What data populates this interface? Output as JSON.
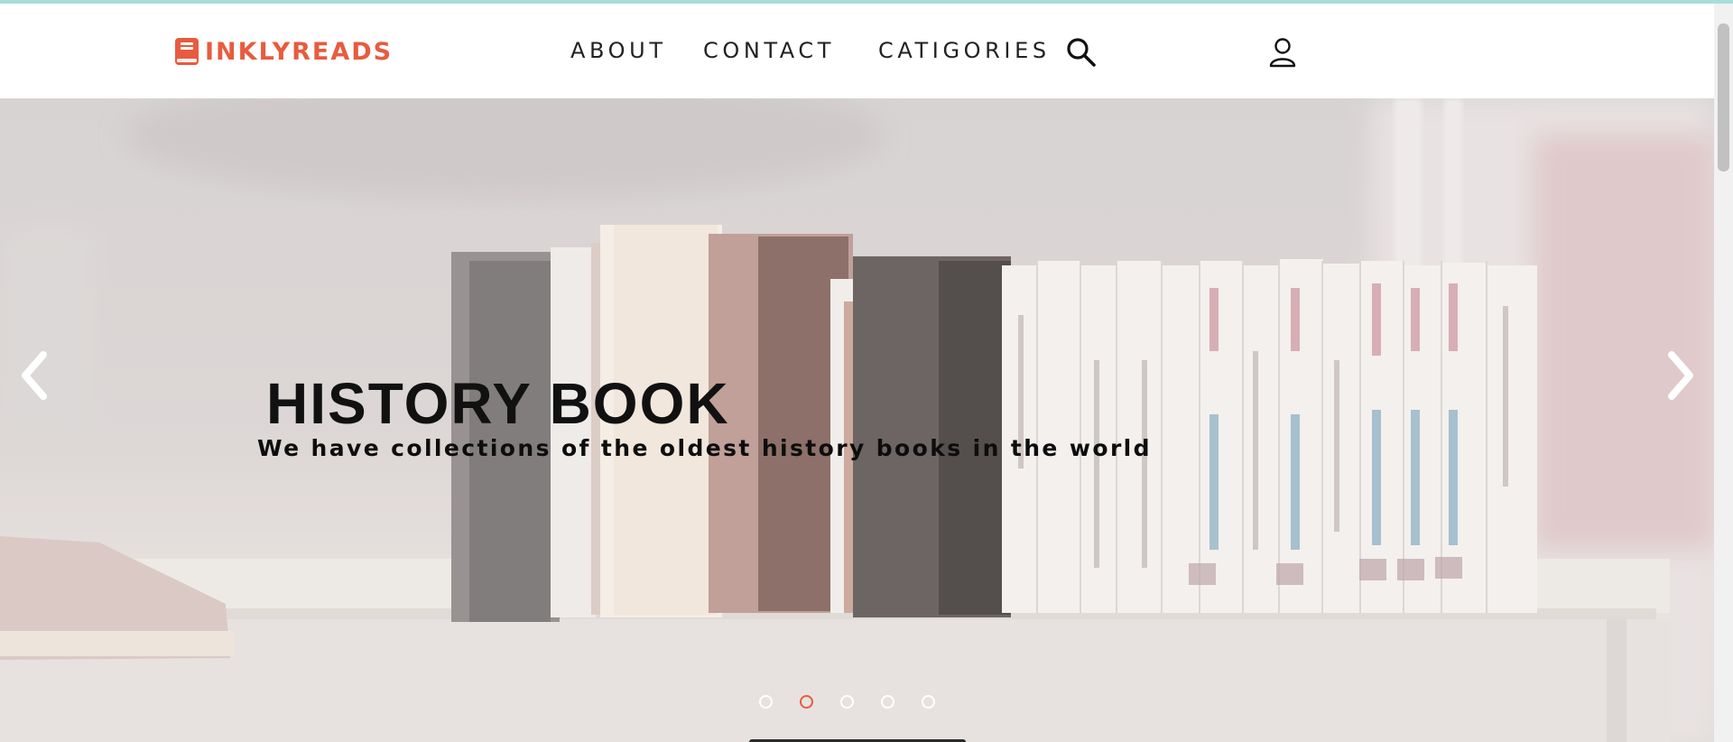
{
  "brand": {
    "name": "INKLYREADS",
    "icon": "book-icon",
    "color": "#e85b3f"
  },
  "nav": {
    "links": [
      {
        "label": "ABOUT"
      },
      {
        "label": "CONTACT"
      },
      {
        "label": "CATIGORIES"
      }
    ],
    "search_icon": "search-icon",
    "user_icon": "user-icon"
  },
  "carousel": {
    "title": "HISTORY BOOK",
    "subtitle": "We have collections of the oldest history books in the world",
    "prev_icon": "chevron-left-icon",
    "next_icon": "chevron-right-icon",
    "slide_count": 5,
    "active_slide": 2,
    "indicator_active_color": "#e85b3f"
  }
}
